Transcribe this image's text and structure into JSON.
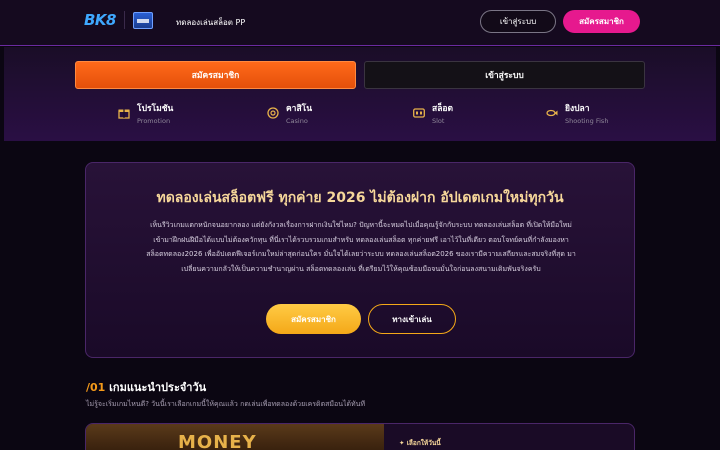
{
  "header": {
    "logo_text": "BK8",
    "title": "ทดลองเล่นสล็อต PP",
    "login_label": "เข้าสู่ระบบ",
    "register_label": "สมัครสมาชิก"
  },
  "actions": {
    "register_label": "สมัครสมาชิก",
    "login_label": "เข้าสู่ระบบ"
  },
  "categories": [
    {
      "title": "โปรโมชัน",
      "sub": "Promotion",
      "icon": "gift-icon"
    },
    {
      "title": "คาสิโน",
      "sub": "Casino",
      "icon": "casino-chip-icon"
    },
    {
      "title": "สล็อต",
      "sub": "Slot",
      "icon": "slot-machine-icon"
    },
    {
      "title": "ยิงปลา",
      "sub": "Shooting Fish",
      "icon": "fish-icon"
    }
  ],
  "hero": {
    "title": "ทดลองเล่นสล็อตฟรี ทุกค่าย 2026 ไม่ต้องฝาก อัปเดตเกมใหม่ทุกวัน",
    "body": "เห็นรีวิวเกมแตกหนักจนอยากลอง แต่ยังกังวลเรื่องการฝากเงินใช่ไหม? ปัญหานี้จะหมดไปเมื่อคุณรู้จักกับระบบ ทดลองเล่นสล็อต ที่เปิดให้มือใหม่เข้ามาฝึกฝนฝีมือได้แบบไม่ต้องควักทุน ที่นี่เราได้รวบรวมเกมสำหรับ ทดลองเล่นสล็อต ทุกค่ายฟรี เอาไว้ในที่เดียว ตอบโจทย์คนที่กำลังมองหา สล็อตทดลอง2026 เพื่ออัปเดตฟีเจอร์เกมใหม่ล่าสุดก่อนใคร มั่นใจได้เลยว่าระบบ ทดลองเล่นสล็อต2026 ของเรามีความเสถียรและสมจริงที่สุด มาเปลี่ยนความกลัวให้เป็นความชำนาญผ่าน สล็อตทดลองเล่น ที่เตรียมไว้ให้คุณซ้อมมือจนมั่นใจก่อนลงสนามเดิมพันจริงครับ",
    "register_label": "สมัครสมาชิก",
    "play_label": "ทางเข้าเล่น"
  },
  "recommended": {
    "number": "/01",
    "title": "เกมแนะนำประจำวัน",
    "subtitle": "ไม่รู้จะเริ่มเกมไหนดี? วันนี้เราเลือกเกมนี้ให้คุณแล้ว กดเล่นเพื่อทดลองด้วยเครดิตสมือนได้ทันที",
    "card_image_text": "MONEY",
    "card_tag": "✦ เลือกให้วันนี้"
  },
  "colors": {
    "accent_orange": "#ff6a1a",
    "accent_pink": "#e6198e",
    "accent_gold": "#f4a818",
    "background": "#0b0612"
  }
}
